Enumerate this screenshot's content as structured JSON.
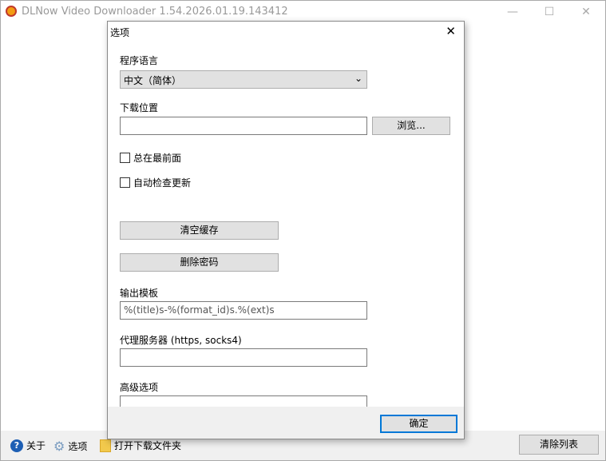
{
  "app": {
    "title": "DLNow Video Downloader 1.54.2026.01.19.143412",
    "minimize": "—",
    "maximize": "☐",
    "close": "✕"
  },
  "bottom": {
    "about": "关于",
    "options": "选项",
    "open_folder": "打开下载文件夹",
    "clear_list": "清除列表"
  },
  "dialog": {
    "title": "选项",
    "close": "✕",
    "language_label": "程序语言",
    "language_value": "中文（简体）",
    "download_location_label": "下载位置",
    "download_location_value": "",
    "browse": "浏览...",
    "always_on_top": "总在最前面",
    "auto_update": "自动检查更新",
    "clear_cache": "清空缓存",
    "delete_passwords": "删除密码",
    "output_template_label": "输出模板",
    "output_template_value": "%(title)s-%(format_id)s.%(ext)s",
    "proxy_label": "代理服务器 (https, socks4)",
    "proxy_value": "",
    "advanced_label": "高级选项",
    "advanced_value": "",
    "ok": "确定"
  }
}
